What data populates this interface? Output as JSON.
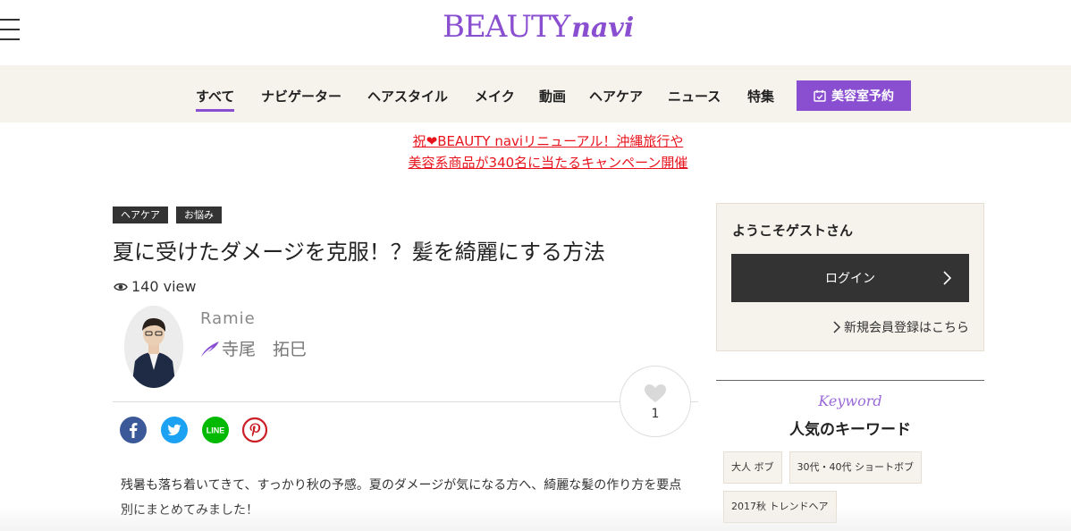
{
  "header": {
    "logo_main": "BEAUTY",
    "logo_sub": "navi"
  },
  "nav": {
    "items": [
      {
        "label": "すべて",
        "active": true
      },
      {
        "label": "ナビゲーター"
      },
      {
        "label": "ヘアスタイル"
      },
      {
        "label": "メイク"
      },
      {
        "label": "動画"
      },
      {
        "label": "ヘアケア"
      },
      {
        "label": "ニュース"
      },
      {
        "label": "特集"
      }
    ],
    "reserve_label": "美容室予約"
  },
  "campaign": {
    "line1": "祝❤BEAUTY naviリニューアル！沖縄旅行や",
    "line2": "美容系商品が340名に当たるキャンペーン開催",
    "color": "#e8141d"
  },
  "article": {
    "tags": [
      "ヘアケア",
      "お悩み"
    ],
    "title": "夏に受けたダメージを克服！？髪を綺麗にする方法",
    "views": "140 view",
    "author": {
      "name_en": "Ramie",
      "name_jp": "寺尾　拓巳"
    },
    "like_count": "1",
    "share": [
      "facebook-icon",
      "twitter-icon",
      "line-icon",
      "pinterest-icon"
    ],
    "lead": "残暑も落ち着いてきて、すっかり秋の予感。夏のダメージが気になる方へ、綺麗な髪の作り方を要点別にまとめてみました！"
  },
  "sidebar": {
    "welcome_title": "ようこそゲストさん",
    "login_label": "ログイン",
    "register_label": "新規会員登録はこちら",
    "keyword_script": "Keyword",
    "keyword_title": "人気のキーワード",
    "keywords": [
      "大人 ボブ",
      "30代・40代 ショートボブ",
      "2017秋 トレンドヘア"
    ]
  },
  "colors": {
    "accent": "#8a4fd1",
    "nav_bg": "#f6f2ec",
    "dark": "#333333"
  }
}
